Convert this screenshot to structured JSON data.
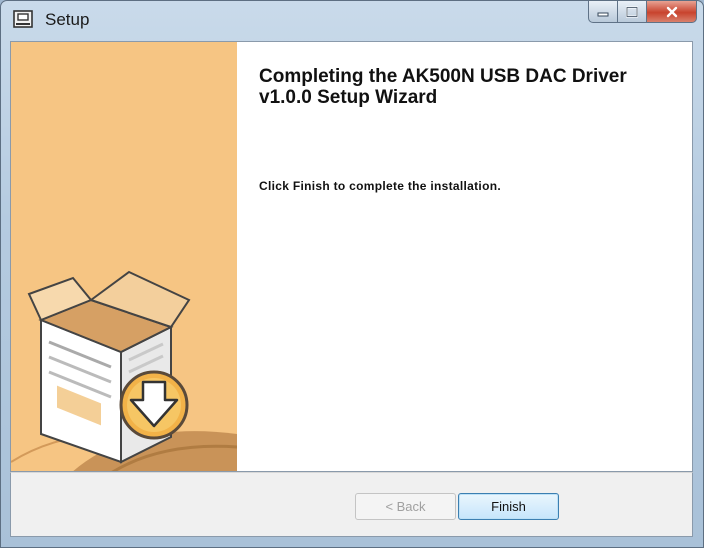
{
  "window": {
    "title": "Setup"
  },
  "wizard": {
    "heading": "Completing the AK500N USB DAC Driver v1.0.0 Setup Wizard",
    "message": "Click Finish to complete the installation.",
    "sidebar_color": "#f6c583"
  },
  "buttons": {
    "back_label": "< Back",
    "finish_label": "Finish"
  },
  "icons": {
    "app": "setup-window-icon",
    "minimize": "minimize-icon",
    "maximize": "maximize-icon",
    "close": "close-icon",
    "installer": "installer-box-download-icon"
  }
}
